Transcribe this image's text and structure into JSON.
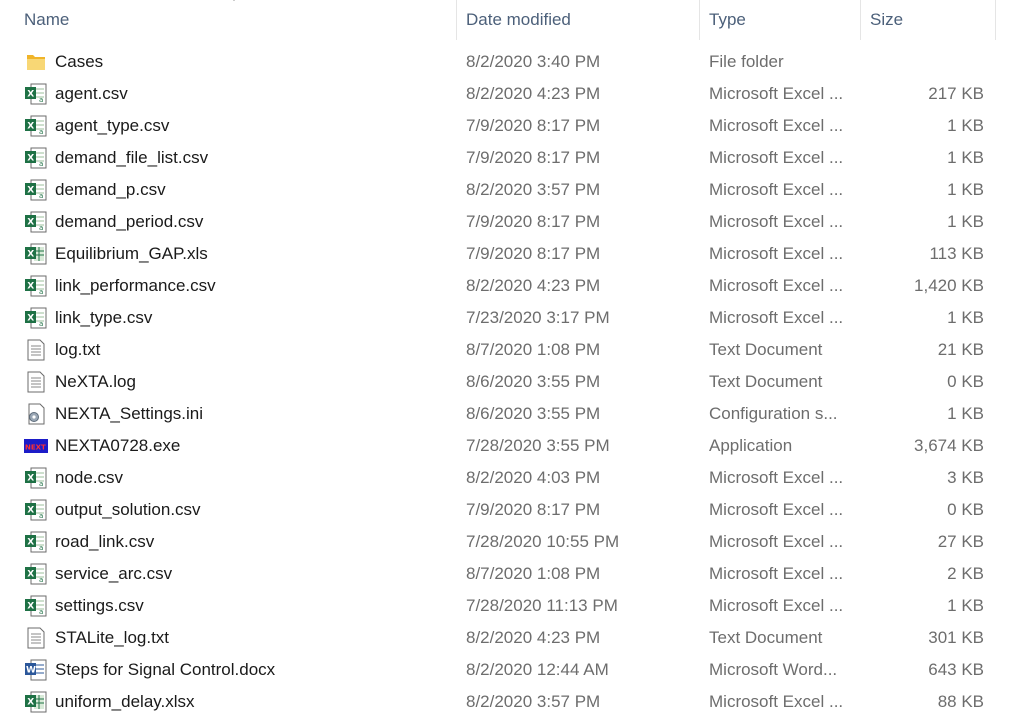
{
  "columns": {
    "name": "Name",
    "date": "Date modified",
    "type": "Type",
    "size": "Size"
  },
  "files": [
    {
      "name": "Cases",
      "date": "8/2/2020 3:40 PM",
      "type": "File folder",
      "size": "",
      "icon": "folder-icon"
    },
    {
      "name": "agent.csv",
      "date": "8/2/2020 4:23 PM",
      "type": "Microsoft Excel ...",
      "size": "217 KB",
      "icon": "excel-csv-icon"
    },
    {
      "name": "agent_type.csv",
      "date": "7/9/2020 8:17 PM",
      "type": "Microsoft Excel ...",
      "size": "1 KB",
      "icon": "excel-csv-icon"
    },
    {
      "name": "demand_file_list.csv",
      "date": "7/9/2020 8:17 PM",
      "type": "Microsoft Excel ...",
      "size": "1 KB",
      "icon": "excel-csv-icon"
    },
    {
      "name": "demand_p.csv",
      "date": "8/2/2020 3:57 PM",
      "type": "Microsoft Excel ...",
      "size": "1 KB",
      "icon": "excel-csv-icon"
    },
    {
      "name": "demand_period.csv",
      "date": "7/9/2020 8:17 PM",
      "type": "Microsoft Excel ...",
      "size": "1 KB",
      "icon": "excel-csv-icon"
    },
    {
      "name": "Equilibrium_GAP.xls",
      "date": "7/9/2020 8:17 PM",
      "type": "Microsoft Excel ...",
      "size": "113 KB",
      "icon": "excel-xls-icon"
    },
    {
      "name": "link_performance.csv",
      "date": "8/2/2020 4:23 PM",
      "type": "Microsoft Excel ...",
      "size": "1,420 KB",
      "icon": "excel-csv-icon"
    },
    {
      "name": "link_type.csv",
      "date": "7/23/2020 3:17 PM",
      "type": "Microsoft Excel ...",
      "size": "1 KB",
      "icon": "excel-csv-icon"
    },
    {
      "name": "log.txt",
      "date": "8/7/2020 1:08 PM",
      "type": "Text Document",
      "size": "21 KB",
      "icon": "text-document-icon"
    },
    {
      "name": "NeXTA.log",
      "date": "8/6/2020 3:55 PM",
      "type": "Text Document",
      "size": "0 KB",
      "icon": "text-document-icon"
    },
    {
      "name": "NEXTA_Settings.ini",
      "date": "8/6/2020 3:55 PM",
      "type": "Configuration s...",
      "size": "1 KB",
      "icon": "settings-file-icon"
    },
    {
      "name": "NEXTA0728.exe",
      "date": "7/28/2020 3:55 PM",
      "type": "Application",
      "size": "3,674 KB",
      "icon": "nexta-app-icon"
    },
    {
      "name": "node.csv",
      "date": "8/2/2020 4:03 PM",
      "type": "Microsoft Excel ...",
      "size": "3 KB",
      "icon": "excel-csv-icon"
    },
    {
      "name": "output_solution.csv",
      "date": "7/9/2020 8:17 PM",
      "type": "Microsoft Excel ...",
      "size": "0 KB",
      "icon": "excel-csv-icon"
    },
    {
      "name": "road_link.csv",
      "date": "7/28/2020 10:55 PM",
      "type": "Microsoft Excel ...",
      "size": "27 KB",
      "icon": "excel-csv-icon"
    },
    {
      "name": "service_arc.csv",
      "date": "8/7/2020 1:08 PM",
      "type": "Microsoft Excel ...",
      "size": "2 KB",
      "icon": "excel-csv-icon"
    },
    {
      "name": "settings.csv",
      "date": "7/28/2020 11:13 PM",
      "type": "Microsoft Excel ...",
      "size": "1 KB",
      "icon": "excel-csv-icon"
    },
    {
      "name": "STALite_log.txt",
      "date": "8/2/2020 4:23 PM",
      "type": "Text Document",
      "size": "301 KB",
      "icon": "text-document-icon"
    },
    {
      "name": "Steps for Signal Control.docx",
      "date": "8/2/2020 12:44 AM",
      "type": "Microsoft Word...",
      "size": "643 KB",
      "icon": "word-document-icon"
    },
    {
      "name": "uniform_delay.xlsx",
      "date": "8/2/2020 3:57 PM",
      "type": "Microsoft Excel ...",
      "size": "88 KB",
      "icon": "excel-xls-icon"
    }
  ],
  "icon_text": {
    "nexta": "NEXT"
  },
  "colors": {
    "header_text": "#4c607a",
    "secondary_text": "#6d6d6d",
    "excel_green": "#1e7145",
    "word_blue": "#2b579a",
    "folder_yellow": "#f5c84c"
  }
}
